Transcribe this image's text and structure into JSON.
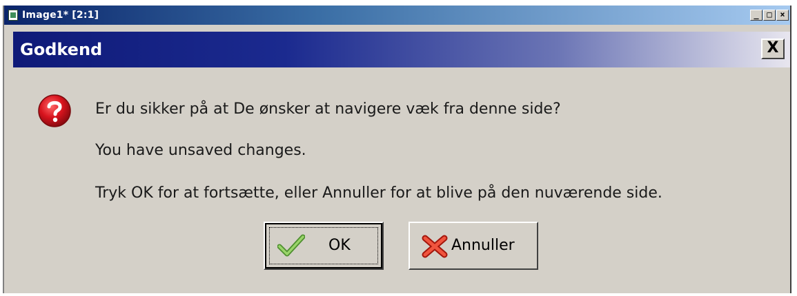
{
  "outer_window": {
    "title": "Image1* [2:1]",
    "controls": {
      "minimize": "_",
      "maximize": "□",
      "close": "×"
    }
  },
  "dialog": {
    "title": "Godkend",
    "close_label": "X",
    "icon": "question-icon",
    "messages": {
      "line1": "Er du sikker på at De ønsker at navigere væk fra denne side?",
      "line2": "You have unsaved changes.",
      "line3": "Tryk OK for at fortsætte, eller Annuller for at blive på den nuværende side."
    },
    "buttons": {
      "ok": {
        "label": "OK",
        "icon": "checkmark-icon"
      },
      "cancel": {
        "label": "Annuller",
        "icon": "red-x-icon"
      }
    },
    "colors": {
      "title_gradient_start": "#0f1a78",
      "title_gradient_end": "#e8e6ef",
      "dialog_background": "#d4d0c8",
      "question_icon": "#d8141e",
      "ok_check": "#6ab04c",
      "cancel_x": "#e03a2a"
    }
  }
}
